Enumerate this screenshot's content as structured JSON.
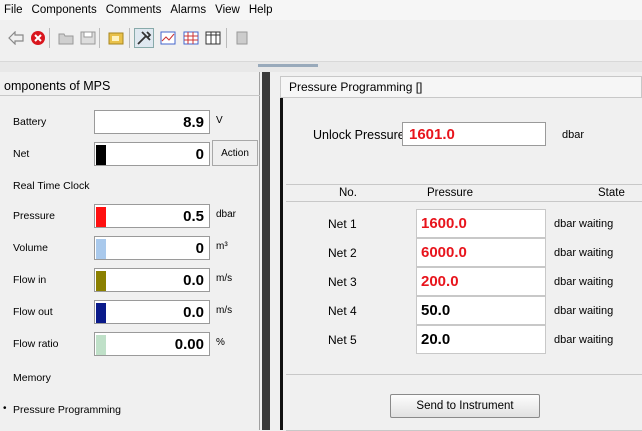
{
  "menu": [
    "File",
    "Components",
    "Comments",
    "Alarms",
    "View",
    "Help"
  ],
  "left_panel": {
    "title": "omponents of MPS",
    "rows": [
      {
        "label": "Battery",
        "value": "8.9",
        "unit": "V",
        "color": "#ffffff"
      },
      {
        "label": "Net",
        "value": "0",
        "action": "Action",
        "color": "#000000"
      },
      {
        "label": "Real Time Clock"
      },
      {
        "label": "Pressure",
        "value": "0.5",
        "unit": "dbar",
        "color": "#ff1010"
      },
      {
        "label": "Volume",
        "value": "0",
        "unit": "m³",
        "color": "#a9c9ec"
      },
      {
        "label": "Flow in",
        "value": "0.0",
        "unit": "m/s",
        "color": "#8b8000"
      },
      {
        "label": "Flow out",
        "value": "0.0",
        "unit": "m/s",
        "color": "#0a1a8a"
      },
      {
        "label": "Flow ratio",
        "value": "0.00",
        "unit": "%",
        "color": "#bfe0c8"
      },
      {
        "label": "Memory"
      },
      {
        "label": "Pressure Programming",
        "bullet": "•"
      }
    ]
  },
  "right_panel": {
    "title": "Pressure Programming []",
    "unlock_label": "Unlock Pressure:",
    "unlock_value": "1601.0",
    "unlock_unit": "dbar",
    "headers": {
      "no": "No.",
      "pressure": "Pressure",
      "state": "State"
    },
    "rows": [
      {
        "name": "Net 1",
        "value": "1600.0",
        "unit": "dbar",
        "state": "waiting",
        "red": true
      },
      {
        "name": "Net 2",
        "value": "6000.0",
        "unit": "dbar",
        "state": "waiting",
        "red": true
      },
      {
        "name": "Net 3",
        "value": "200.0",
        "unit": "dbar",
        "state": "waiting",
        "red": true
      },
      {
        "name": "Net 4",
        "value": "50.0",
        "unit": "dbar",
        "state": "waiting",
        "red": false
      },
      {
        "name": "Net 5",
        "value": "20.0",
        "unit": "dbar",
        "state": "waiting",
        "red": false
      }
    ],
    "send_button": "Send to Instrument"
  },
  "toolbar_icons": [
    "back-icon",
    "stop-icon",
    "open-icon",
    "save-icon",
    "folder-icon",
    "tools-icon",
    "chart-icon",
    "grid-icon",
    "table-icon",
    "panel-icon"
  ]
}
